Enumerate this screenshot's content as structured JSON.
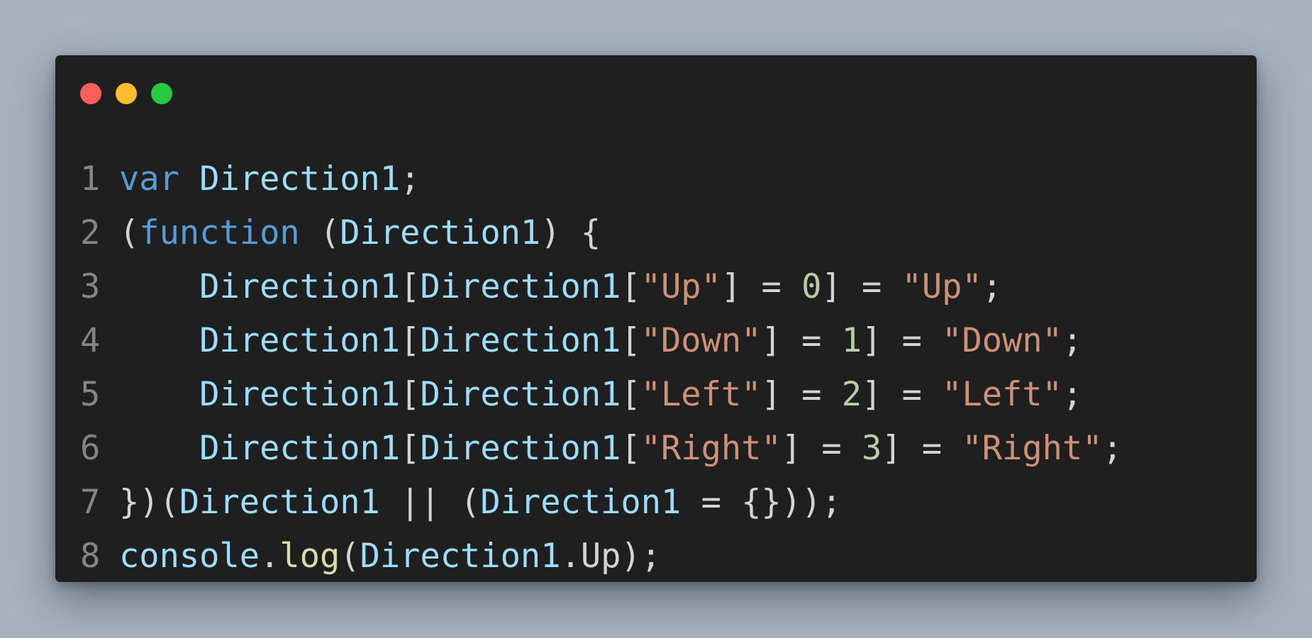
{
  "window": {
    "controls": [
      "close",
      "minimize",
      "maximize"
    ],
    "colors": {
      "background": "#1f1f1f",
      "close": "#ff5f56",
      "minimize": "#ffbd2e",
      "maximize": "#27c93f",
      "line_number": "#858585"
    }
  },
  "code": {
    "language": "javascript",
    "lines": [
      {
        "number": "1",
        "tokens": [
          {
            "t": "var",
            "k": "keyword"
          },
          {
            "t": " ",
            "k": "punct"
          },
          {
            "t": "Direction1",
            "k": "ident"
          },
          {
            "t": ";",
            "k": "punct"
          }
        ]
      },
      {
        "number": "2",
        "tokens": [
          {
            "t": "(",
            "k": "punct"
          },
          {
            "t": "function",
            "k": "keyword"
          },
          {
            "t": " (",
            "k": "punct"
          },
          {
            "t": "Direction1",
            "k": "ident"
          },
          {
            "t": ") {",
            "k": "punct"
          }
        ]
      },
      {
        "number": "3",
        "tokens": [
          {
            "t": "    ",
            "k": "punct"
          },
          {
            "t": "Direction1",
            "k": "ident"
          },
          {
            "t": "[",
            "k": "punct"
          },
          {
            "t": "Direction1",
            "k": "ident"
          },
          {
            "t": "[",
            "k": "punct"
          },
          {
            "t": "\"Up\"",
            "k": "string"
          },
          {
            "t": "] = ",
            "k": "punct"
          },
          {
            "t": "0",
            "k": "number"
          },
          {
            "t": "] = ",
            "k": "punct"
          },
          {
            "t": "\"Up\"",
            "k": "string"
          },
          {
            "t": ";",
            "k": "punct"
          }
        ]
      },
      {
        "number": "4",
        "tokens": [
          {
            "t": "    ",
            "k": "punct"
          },
          {
            "t": "Direction1",
            "k": "ident"
          },
          {
            "t": "[",
            "k": "punct"
          },
          {
            "t": "Direction1",
            "k": "ident"
          },
          {
            "t": "[",
            "k": "punct"
          },
          {
            "t": "\"Down\"",
            "k": "string"
          },
          {
            "t": "] = ",
            "k": "punct"
          },
          {
            "t": "1",
            "k": "number"
          },
          {
            "t": "] = ",
            "k": "punct"
          },
          {
            "t": "\"Down\"",
            "k": "string"
          },
          {
            "t": ";",
            "k": "punct"
          }
        ]
      },
      {
        "number": "5",
        "tokens": [
          {
            "t": "    ",
            "k": "punct"
          },
          {
            "t": "Direction1",
            "k": "ident"
          },
          {
            "t": "[",
            "k": "punct"
          },
          {
            "t": "Direction1",
            "k": "ident"
          },
          {
            "t": "[",
            "k": "punct"
          },
          {
            "t": "\"Left\"",
            "k": "string"
          },
          {
            "t": "] = ",
            "k": "punct"
          },
          {
            "t": "2",
            "k": "number"
          },
          {
            "t": "] = ",
            "k": "punct"
          },
          {
            "t": "\"Left\"",
            "k": "string"
          },
          {
            "t": ";",
            "k": "punct"
          }
        ]
      },
      {
        "number": "6",
        "tokens": [
          {
            "t": "    ",
            "k": "punct"
          },
          {
            "t": "Direction1",
            "k": "ident"
          },
          {
            "t": "[",
            "k": "punct"
          },
          {
            "t": "Direction1",
            "k": "ident"
          },
          {
            "t": "[",
            "k": "punct"
          },
          {
            "t": "\"Right\"",
            "k": "string"
          },
          {
            "t": "] = ",
            "k": "punct"
          },
          {
            "t": "3",
            "k": "number"
          },
          {
            "t": "] = ",
            "k": "punct"
          },
          {
            "t": "\"Right\"",
            "k": "string"
          },
          {
            "t": ";",
            "k": "punct"
          }
        ]
      },
      {
        "number": "7",
        "tokens": [
          {
            "t": "})(",
            "k": "punct"
          },
          {
            "t": "Direction1",
            "k": "ident"
          },
          {
            "t": " || (",
            "k": "punct"
          },
          {
            "t": "Direction1",
            "k": "ident"
          },
          {
            "t": " = {}));",
            "k": "punct"
          }
        ]
      },
      {
        "number": "8",
        "tokens": [
          {
            "t": "console",
            "k": "ident"
          },
          {
            "t": ".",
            "k": "punct"
          },
          {
            "t": "log",
            "k": "func"
          },
          {
            "t": "(",
            "k": "punct"
          },
          {
            "t": "Direction1",
            "k": "ident"
          },
          {
            "t": ".Up);",
            "k": "punct"
          }
        ]
      }
    ]
  }
}
